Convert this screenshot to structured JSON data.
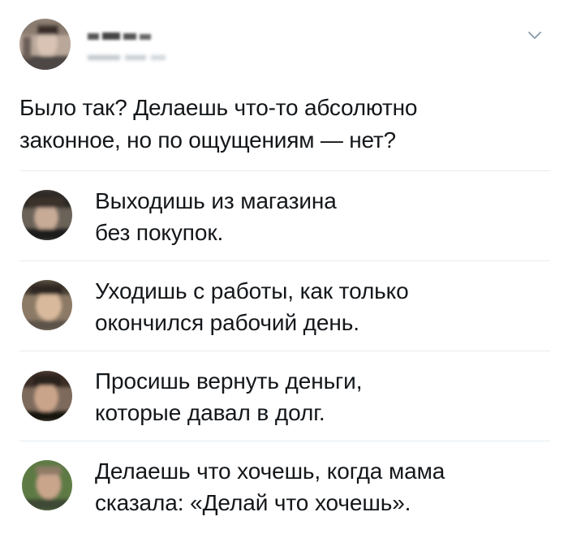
{
  "post": {
    "question": "Было так? Делаешь что-то абсолютно\nзаконное, но по ощущениям — нет?"
  },
  "replies": [
    {
      "text": "Выходишь из магазина\nбез покупок."
    },
    {
      "text": "Уходишь с работы, как только\nокончился рабочий день."
    },
    {
      "text": "Просишь вернуть деньги,\nкоторые давал в долг."
    },
    {
      "text": "Делаешь что хочешь, когда мама\nсказала: «Делай что хочешь»."
    }
  ],
  "icons": {
    "menu": "chevron-down-icon"
  },
  "colors": {
    "text": "#14171a",
    "divider": "#e6ecf0",
    "chevron": "#8899a6"
  }
}
